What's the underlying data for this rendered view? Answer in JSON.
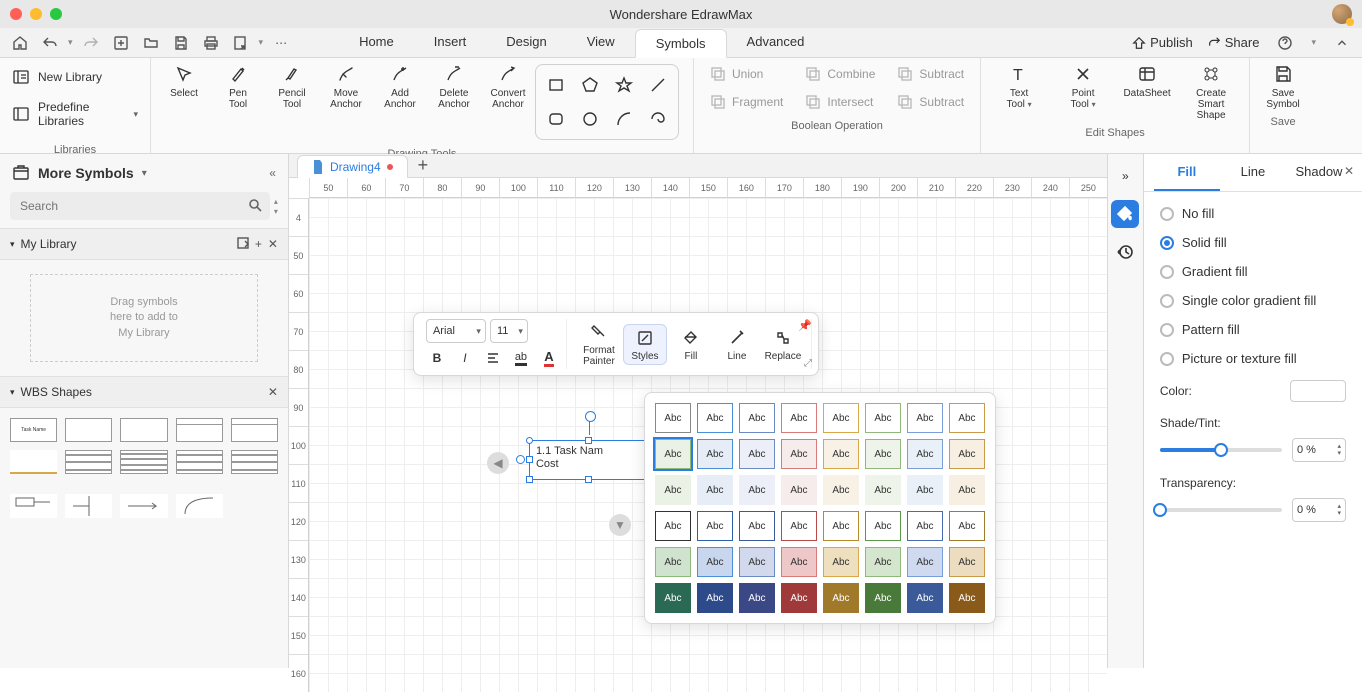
{
  "app_title": "Wondershare EdrawMax",
  "menu_tabs": [
    "Home",
    "Insert",
    "Design",
    "View",
    "Symbols",
    "Advanced"
  ],
  "active_menu_tab": 4,
  "toprow_right": {
    "publish": "Publish",
    "share": "Share"
  },
  "ribbon": {
    "left_items": [
      "New Library",
      "Predefine Libraries"
    ],
    "left_label": "Libraries",
    "tools": [
      "Select",
      "Pen\nTool",
      "Pencil\nTool",
      "Move\nAnchor",
      "Add\nAnchor",
      "Delete\nAnchor",
      "Convert\nAnchor"
    ],
    "tools_label": "Drawing Tools",
    "boolean_ops": [
      "Union",
      "Combine",
      "Subtract",
      "Fragment",
      "Intersect",
      "Subtract"
    ],
    "boolean_label": "Boolean Operation",
    "edit_tools": [
      "Text\nTool",
      "Point\nTool",
      "DataSheet",
      "Create Smart\nShape"
    ],
    "edit_label": "Edit Shapes",
    "save_tool": "Save\nSymbol",
    "save_label": "Save"
  },
  "left_panel": {
    "title": "More Symbols",
    "search_placeholder": "Search",
    "my_library": "My Library",
    "drop_hint": "Drag symbols\nhere to add to\nMy Library",
    "wbs_title": "WBS Shapes",
    "wbs_sample": "Task Name"
  },
  "file_tab": {
    "name": "Drawing4"
  },
  "ruler_h": [
    "50",
    "60",
    "70",
    "80",
    "90",
    "100",
    "110",
    "120",
    "130",
    "140",
    "150",
    "160",
    "170",
    "180",
    "190",
    "200",
    "210",
    "220",
    "230",
    "240",
    "250"
  ],
  "ruler_v": [
    "4",
    "50",
    "60",
    "70",
    "80",
    "90",
    "100",
    "110",
    "120",
    "130",
    "140",
    "150",
    "160"
  ],
  "canvas_shape": {
    "line1": "1.1 Task Nam",
    "line2": "Cost"
  },
  "mini_toolbar": {
    "font": "Arial",
    "size": "11",
    "tools": [
      "Format\nPainter",
      "Styles",
      "Fill",
      "Line",
      "Replace"
    ],
    "active_tool": 1
  },
  "style_swatches": [
    {
      "fill": "#ffffff",
      "border": "#888888",
      "text": "#333"
    },
    {
      "fill": "#ffffff",
      "border": "#4a90d9",
      "text": "#333"
    },
    {
      "fill": "#ffffff",
      "border": "#6a8bc4",
      "text": "#333"
    },
    {
      "fill": "#ffffff",
      "border": "#d87a7a",
      "text": "#333"
    },
    {
      "fill": "#ffffff",
      "border": "#d8a84a",
      "text": "#333"
    },
    {
      "fill": "#ffffff",
      "border": "#8fb97a",
      "text": "#333"
    },
    {
      "fill": "#ffffff",
      "border": "#7a9fd8",
      "text": "#333"
    },
    {
      "fill": "#ffffff",
      "border": "#c99a4a",
      "text": "#333"
    },
    {
      "fill": "#e9f2e5",
      "border": "#8fb97a",
      "text": "#333",
      "sel": true
    },
    {
      "fill": "#e6edf7",
      "border": "#4a90d9",
      "text": "#333"
    },
    {
      "fill": "#eceff7",
      "border": "#6a8bc4",
      "text": "#333"
    },
    {
      "fill": "#f7ecec",
      "border": "#d87a7a",
      "text": "#333"
    },
    {
      "fill": "#f7f1e6",
      "border": "#d8a84a",
      "text": "#333"
    },
    {
      "fill": "#eef4ea",
      "border": "#8fb97a",
      "text": "#333"
    },
    {
      "fill": "#eaf0f8",
      "border": "#7a9fd8",
      "text": "#333"
    },
    {
      "fill": "#f6efe2",
      "border": "#c99a4a",
      "text": "#333"
    },
    {
      "fill": "#e9f2e5",
      "border": "#e9f2e5",
      "text": "#333"
    },
    {
      "fill": "#e6edf7",
      "border": "#e6edf7",
      "text": "#333"
    },
    {
      "fill": "#eceff7",
      "border": "#eceff7",
      "text": "#333"
    },
    {
      "fill": "#f7ecec",
      "border": "#f7ecec",
      "text": "#333"
    },
    {
      "fill": "#f7f1e6",
      "border": "#f7f1e6",
      "text": "#333"
    },
    {
      "fill": "#eef4ea",
      "border": "#eef4ea",
      "text": "#333"
    },
    {
      "fill": "#eaf0f8",
      "border": "#eaf0f8",
      "text": "#333"
    },
    {
      "fill": "#f6efe2",
      "border": "#f6efe2",
      "text": "#333"
    },
    {
      "fill": "#ffffff",
      "border": "#333333",
      "text": "#333"
    },
    {
      "fill": "#ffffff",
      "border": "#2d5faa",
      "text": "#333"
    },
    {
      "fill": "#ffffff",
      "border": "#3a5a9a",
      "text": "#333"
    },
    {
      "fill": "#ffffff",
      "border": "#b84a4a",
      "text": "#333"
    },
    {
      "fill": "#ffffff",
      "border": "#b88a2a",
      "text": "#333"
    },
    {
      "fill": "#ffffff",
      "border": "#5a9a4a",
      "text": "#333"
    },
    {
      "fill": "#ffffff",
      "border": "#4a6ab0",
      "text": "#333"
    },
    {
      "fill": "#ffffff",
      "border": "#a07a2a",
      "text": "#333"
    },
    {
      "fill": "#cfe3cf",
      "border": "#8fb97a",
      "text": "#333"
    },
    {
      "fill": "#c8d7ee",
      "border": "#4a90d9",
      "text": "#333"
    },
    {
      "fill": "#d2d9ec",
      "border": "#6a8bc4",
      "text": "#333"
    },
    {
      "fill": "#eec8c8",
      "border": "#d87a7a",
      "text": "#333"
    },
    {
      "fill": "#eedfbf",
      "border": "#d8a84a",
      "text": "#333"
    },
    {
      "fill": "#d5e6cf",
      "border": "#8fb97a",
      "text": "#333"
    },
    {
      "fill": "#cfdaf0",
      "border": "#7a9fd8",
      "text": "#333"
    },
    {
      "fill": "#ecdcc0",
      "border": "#c99a4a",
      "text": "#333"
    },
    {
      "fill": "#2a6a54",
      "border": "#2a6a54",
      "text": "#fff"
    },
    {
      "fill": "#2d4a8a",
      "border": "#2d4a8a",
      "text": "#fff"
    },
    {
      "fill": "#3a4886",
      "border": "#3a4886",
      "text": "#fff"
    },
    {
      "fill": "#a03a3a",
      "border": "#a03a3a",
      "text": "#fff"
    },
    {
      "fill": "#a07a2a",
      "border": "#a07a2a",
      "text": "#fff"
    },
    {
      "fill": "#4a7a3a",
      "border": "#4a7a3a",
      "text": "#fff"
    },
    {
      "fill": "#3a5a9a",
      "border": "#3a5a9a",
      "text": "#fff"
    },
    {
      "fill": "#8a5a1a",
      "border": "#8a5a1a",
      "text": "#fff"
    }
  ],
  "swatch_label": "Abc",
  "right_panel": {
    "tabs": [
      "Fill",
      "Line",
      "Shadow"
    ],
    "active_tab": 0,
    "fill_options": [
      "No fill",
      "Solid fill",
      "Gradient fill",
      "Single color gradient fill",
      "Pattern fill",
      "Picture or texture fill"
    ],
    "fill_selected": 1,
    "color_label": "Color:",
    "shade_label": "Shade/Tint:",
    "shade_value": "0 %",
    "shade_pct": 50,
    "transparency_label": "Transparency:",
    "transparency_value": "0 %",
    "transparency_pct": 0
  }
}
